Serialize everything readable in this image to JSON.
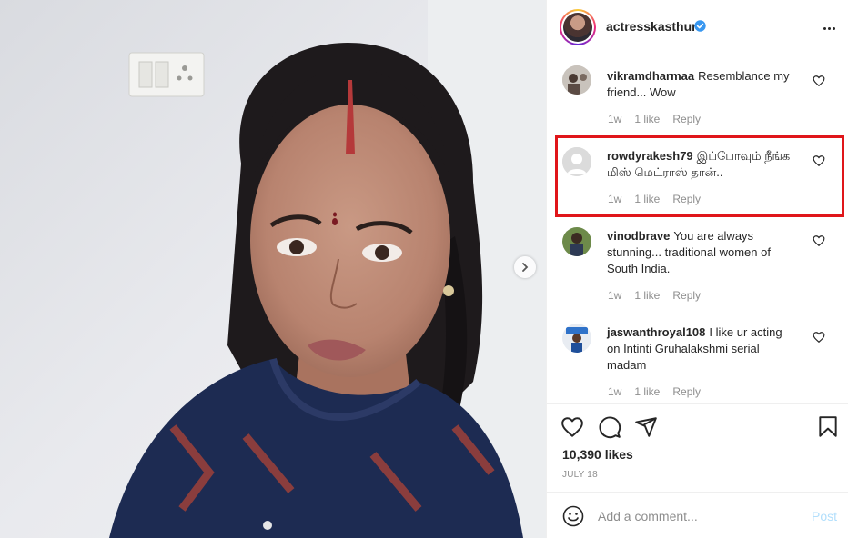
{
  "post": {
    "username": "actresskasthuri",
    "verified": true,
    "more_icon": "more-horizontal-icon",
    "next_icon": "chevron-right-icon"
  },
  "comments": [
    {
      "user": "vikramdharmaa",
      "text": "Resemblance my friend... Wow",
      "time": "1w",
      "likes": "1 like",
      "reply": "Reply"
    },
    {
      "user": "rowdyrakesh79",
      "text": "இப்போவும் நீங்க மிஸ் மெட்ராஸ் தான்..",
      "time": "1w",
      "likes": "1 like",
      "reply": "Reply"
    },
    {
      "user": "vinodbrave",
      "text": "You are always stunning... traditional women of South India.",
      "time": "1w",
      "likes": "1 like",
      "reply": "Reply"
    },
    {
      "user": "jaswanthroyal108",
      "text": "I like ur acting on Intinti Gruhalakshmi serial madam",
      "time": "1w",
      "likes": "1 like",
      "reply": "Reply"
    }
  ],
  "actions": {
    "icons": [
      "heart-icon",
      "comment-icon",
      "share-icon",
      "bookmark-icon"
    ],
    "likes": "10,390 likes",
    "date": "JULY 18"
  },
  "add_comment": {
    "placeholder": "Add a comment...",
    "post_label": "Post",
    "emoji_icon": "emoji-icon"
  },
  "colors": {
    "highlight": "#e0161a",
    "verified": "#3897f0",
    "post_disabled": "#b2dffc",
    "muted": "#8e8e8e"
  }
}
